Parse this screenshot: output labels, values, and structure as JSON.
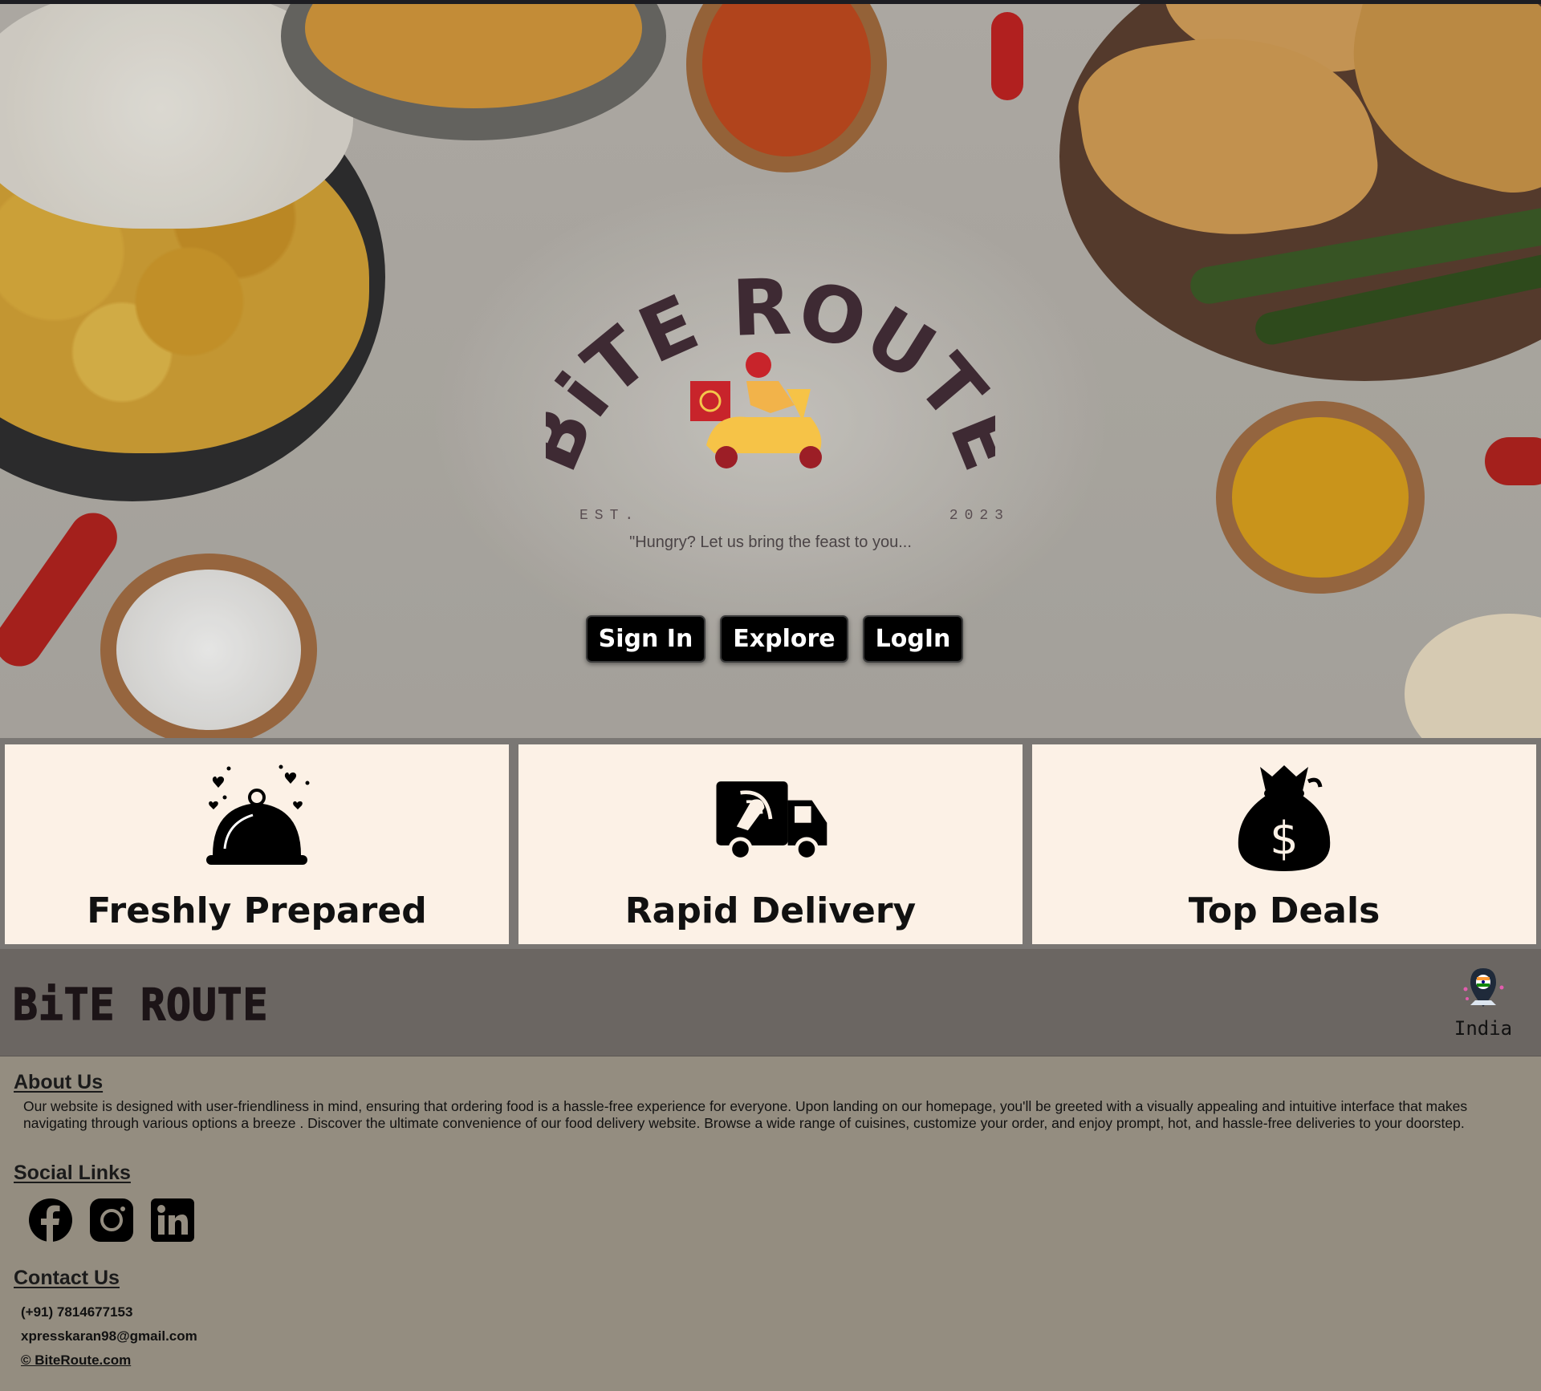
{
  "hero": {
    "brand": "BiTE ROUTE",
    "est_left": "EST.",
    "est_right": "2023",
    "tagline": "\"Hungry? Let us bring the feast to you...",
    "buttons": {
      "signin": "Sign In",
      "explore": "Explore",
      "login": "LogIn"
    }
  },
  "features": [
    {
      "title": "Freshly Prepared",
      "icon": "food-cloche-icon"
    },
    {
      "title": "Rapid Delivery",
      "icon": "delivery-truck-icon"
    },
    {
      "title": "Top Deals",
      "icon": "money-bag-icon"
    }
  ],
  "brandbar": {
    "logo": "BiTE ROUTE",
    "location": "India",
    "location_icon": "location-pin-icon"
  },
  "about": {
    "title": "About Us",
    "text": "Our website is designed with user-friendliness in mind, ensuring that ordering food is a hassle-free experience for everyone. Upon landing on our homepage, you'll be greeted with a visually appealing and intuitive interface that makes navigating through various options a breeze . Discover the ultimate convenience of our food delivery website. Browse a wide range of cuisines, customize your order, and enjoy prompt, hot, and hassle-free deliveries to your doorstep."
  },
  "social": {
    "title": "Social Links",
    "icons": [
      "facebook-icon",
      "instagram-icon",
      "linkedin-icon"
    ]
  },
  "contact": {
    "title": "Contact Us",
    "phone": "(+91) 7814677153",
    "email": "xpresskaran98@gmail.com",
    "copyright": "© BiteRoute.com"
  },
  "colors": {
    "feature_bg": "#fcf1e6",
    "brandbar_bg": "#6b6662",
    "footer_bg": "#948d80",
    "logo_text": "#3e2a33",
    "button_bg": "#000000"
  }
}
